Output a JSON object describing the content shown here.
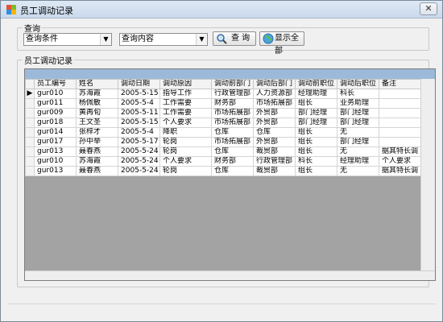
{
  "window": {
    "title": "员工调动记录",
    "close_icon": "close-icon",
    "app_icon": "app-icon"
  },
  "query": {
    "group_label": "查询",
    "condition_select": "查询条件",
    "content_select": "查询内容",
    "query_button": "查 询",
    "show_all_button": "显示全部",
    "query_icon": "search-icon",
    "show_all_icon": "globe-icon"
  },
  "records": {
    "group_label": "员工调动记录",
    "columns": [
      "员工编号",
      "姓名",
      "调动日期",
      "调动原因",
      "调动前部门",
      "调动后部门",
      "调动前职位",
      "调动后职位",
      "备注"
    ],
    "rows": [
      [
        "gur010",
        "苏海霞",
        "2005-5-15",
        "指导工作",
        "行政管理部",
        "人力资源部",
        "经理助理",
        "科长",
        ""
      ],
      [
        "gur011",
        "杨佩敏",
        "2005-5-4",
        "工作需要",
        "财务部",
        "市场拓展部",
        "组长",
        "业务助理",
        ""
      ],
      [
        "gur009",
        "黄再旬",
        "2005-5-11",
        "工作需要",
        "市场拓展部",
        "外贸部",
        "部门经理",
        "部门经理",
        ""
      ],
      [
        "gur018",
        "王文圣",
        "2005-5-15",
        "个人要求",
        "市场拓展部",
        "外贸部",
        "部门经理",
        "部门经理",
        ""
      ],
      [
        "gur014",
        "张梓才",
        "2005-5-4",
        "降职",
        "仓库",
        "仓库",
        "组长",
        "无",
        ""
      ],
      [
        "gur017",
        "孙中举",
        "2005-5-17",
        "轮岗",
        "市场拓展部",
        "外贸部",
        "组长",
        "部门经理",
        ""
      ],
      [
        "gur013",
        "聂春燕",
        "2005-5-24",
        "轮岗",
        "仓库",
        "裁贸部",
        "组长",
        "无",
        "据其特长调"
      ],
      [
        "gur010",
        "苏海霞",
        "2005-5-24",
        "个人要求",
        "财务部",
        "行政管理部",
        "科长",
        "经理助理",
        "个人要求"
      ],
      [
        "gur013",
        "聂春燕",
        "2005-5-24",
        "轮岗",
        "仓库",
        "裁贸部",
        "组长",
        "无",
        "据其特长调"
      ]
    ],
    "current_row_indicator": "▶"
  }
}
